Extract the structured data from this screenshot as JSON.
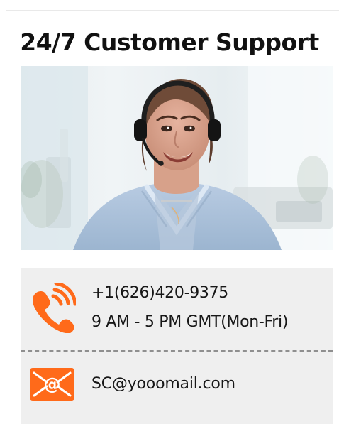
{
  "support": {
    "title": "24/7 Customer Support",
    "contact": {
      "phone": "+1(626)420-9375",
      "hours": "9 AM - 5 PM GMT(Mon-Fri)",
      "email": "SC@yooomail.com"
    }
  },
  "icons": {
    "phone": "phone-icon",
    "email": "email-icon",
    "photo": "support-agent-photo"
  },
  "colors": {
    "accent": "#FF6A1A",
    "text": "#171717",
    "panel": "#EFEFEF"
  }
}
